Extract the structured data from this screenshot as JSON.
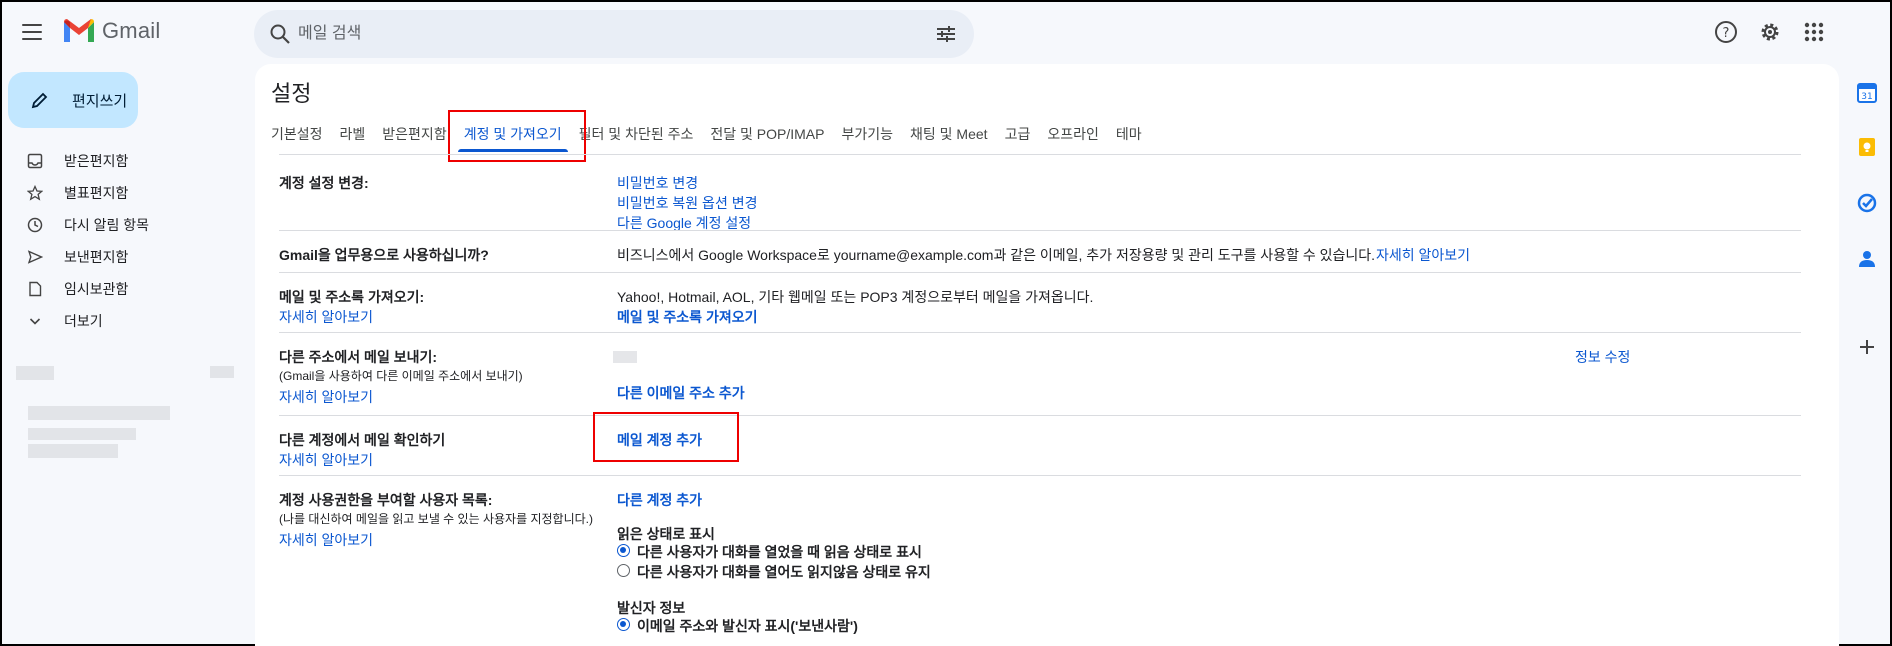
{
  "app": {
    "name": "Gmail"
  },
  "search": {
    "placeholder": "메일 검색"
  },
  "colors": {
    "accent": "#0b57d0",
    "compose_bg": "#c2e7ff",
    "highlight_box": "#ee0000"
  },
  "compose": {
    "label": "편지쓰기"
  },
  "nav": {
    "items": [
      {
        "label": "받은편지함",
        "icon": "inbox-icon"
      },
      {
        "label": "별표편지함",
        "icon": "star-icon"
      },
      {
        "label": "다시 알림 항목",
        "icon": "clock-icon"
      },
      {
        "label": "보낸편지함",
        "icon": "send-icon"
      },
      {
        "label": "임시보관함",
        "icon": "draft-icon"
      },
      {
        "label": "더보기",
        "icon": "chevron-down-icon"
      }
    ]
  },
  "settings": {
    "title": "설정",
    "tabs": [
      {
        "label": "기본설정"
      },
      {
        "label": "라벨"
      },
      {
        "label": "받은편지함"
      },
      {
        "label": "계정 및 가져오기",
        "active": true
      },
      {
        "label": "필터 및 차단된 주소"
      },
      {
        "label": "전달 및 POP/IMAP"
      },
      {
        "label": "부가기능"
      },
      {
        "label": "채팅 및 Meet"
      },
      {
        "label": "고급"
      },
      {
        "label": "오프라인"
      },
      {
        "label": "테마"
      }
    ],
    "sections": {
      "account_change": {
        "label": "계정 설정 변경:",
        "links": [
          "비밀번호 변경",
          "비밀번호 복원 옵션 변경",
          "다른 Google 계정 설정"
        ]
      },
      "business": {
        "label": "Gmail을 업무용으로 사용하십니까?",
        "text": "비즈니스에서 Google Workspace로 yourname@example.com과 같은 이메일, 추가 저장용량 및 관리 도구를 사용할 수 있습니다.",
        "link": "자세히 알아보기"
      },
      "import": {
        "label": "메일 및 주소록 가져오기:",
        "learn": "자세히 알아보기",
        "text": "Yahoo!, Hotmail, AOL, 기타 웹메일 또는 POP3 계정으로부터 메일을 가져옵니다.",
        "action": "메일 및 주소록 가져오기"
      },
      "send_as": {
        "label": "다른 주소에서 메일 보내기:",
        "sub": "(Gmail을 사용하여 다른 이메일 주소에서 보내기)",
        "learn": "자세히 알아보기",
        "edit": "정보 수정",
        "action": "다른 이메일 주소 추가"
      },
      "check_mail": {
        "label": "다른 계정에서 메일 확인하기",
        "learn": "자세히 알아보기",
        "action": "메일 계정 추가"
      },
      "delegate": {
        "label": "계정 사용권한을 부여할 사용자 목록:",
        "sub": "(나를 대신하여 메일을 읽고 보낼 수 있는 사용자를 지정합니다.)",
        "learn": "자세히 알아보기",
        "action": "다른 계정 추가",
        "read_status_title": "읽은 상태로 표시",
        "read_opt1": "다른 사용자가 대화를 열었을 때 읽음 상태로 표시",
        "read_opt2": "다른 사용자가 대화를 열어도 읽지않음 상태로 유지",
        "sender_title": "발신자 정보",
        "sender_opt1": "이메일 주소와 발신자 표시('보낸사람')"
      }
    }
  }
}
